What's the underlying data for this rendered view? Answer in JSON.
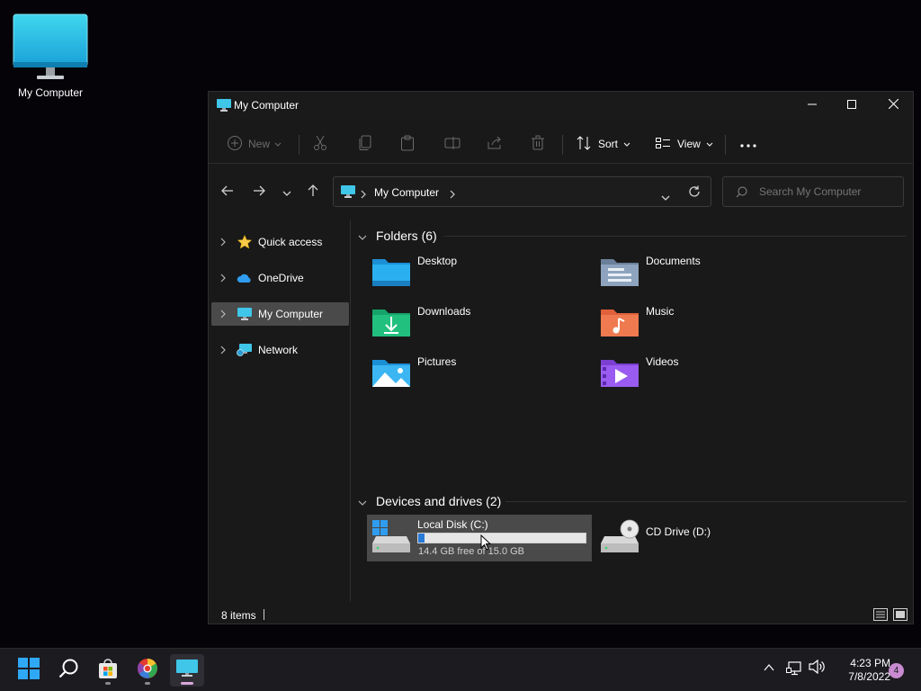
{
  "desktop": {
    "icon_label": "My Computer"
  },
  "window": {
    "title": "My Computer",
    "controls": {
      "minimize": "minimize-icon",
      "maximize": "maximize-icon",
      "close": "close-icon"
    }
  },
  "toolbar": {
    "new_label": "New",
    "sort_label": "Sort",
    "view_label": "View",
    "icons": [
      "cut-icon",
      "copy-icon",
      "paste-icon",
      "rename-icon",
      "share-icon",
      "delete-icon",
      "more-icon"
    ]
  },
  "navigation": {
    "breadcrumb": "My Computer",
    "search_placeholder": "Search My Computer"
  },
  "sidebar": {
    "items": [
      {
        "label": "Quick access",
        "icon": "star-icon"
      },
      {
        "label": "OneDrive",
        "icon": "cloud-icon"
      },
      {
        "label": "My Computer",
        "icon": "computer-icon",
        "active": true
      },
      {
        "label": "Network",
        "icon": "network-icon"
      }
    ]
  },
  "content": {
    "folders_header": "Folders (6)",
    "folders": [
      {
        "name": "Desktop",
        "icon": "desktop-folder-icon"
      },
      {
        "name": "Documents",
        "icon": "documents-folder-icon"
      },
      {
        "name": "Downloads",
        "icon": "downloads-folder-icon"
      },
      {
        "name": "Music",
        "icon": "music-folder-icon"
      },
      {
        "name": "Pictures",
        "icon": "pictures-folder-icon"
      },
      {
        "name": "Videos",
        "icon": "videos-folder-icon"
      }
    ],
    "drives_header": "Devices and drives (2)",
    "drives": [
      {
        "name": "Local Disk (C:)",
        "free_text": "14.4 GB free of 15.0 GB",
        "used_fraction": 0.04,
        "icon": "hard-drive-icon"
      },
      {
        "name": "CD Drive (D:)",
        "icon": "cd-drive-icon"
      }
    ]
  },
  "status": {
    "items_count": "8 items"
  },
  "taskbar": {
    "apps": [
      "start-icon",
      "search-icon",
      "store-icon",
      "browser-icon",
      "explorer-icon"
    ],
    "time": "4:23 PM",
    "date": "7/8/2022",
    "notification_count": "4"
  },
  "colors": {
    "accent": "#2a7ad8",
    "selection": "#4a4a4a",
    "window_bg": "#191919"
  }
}
